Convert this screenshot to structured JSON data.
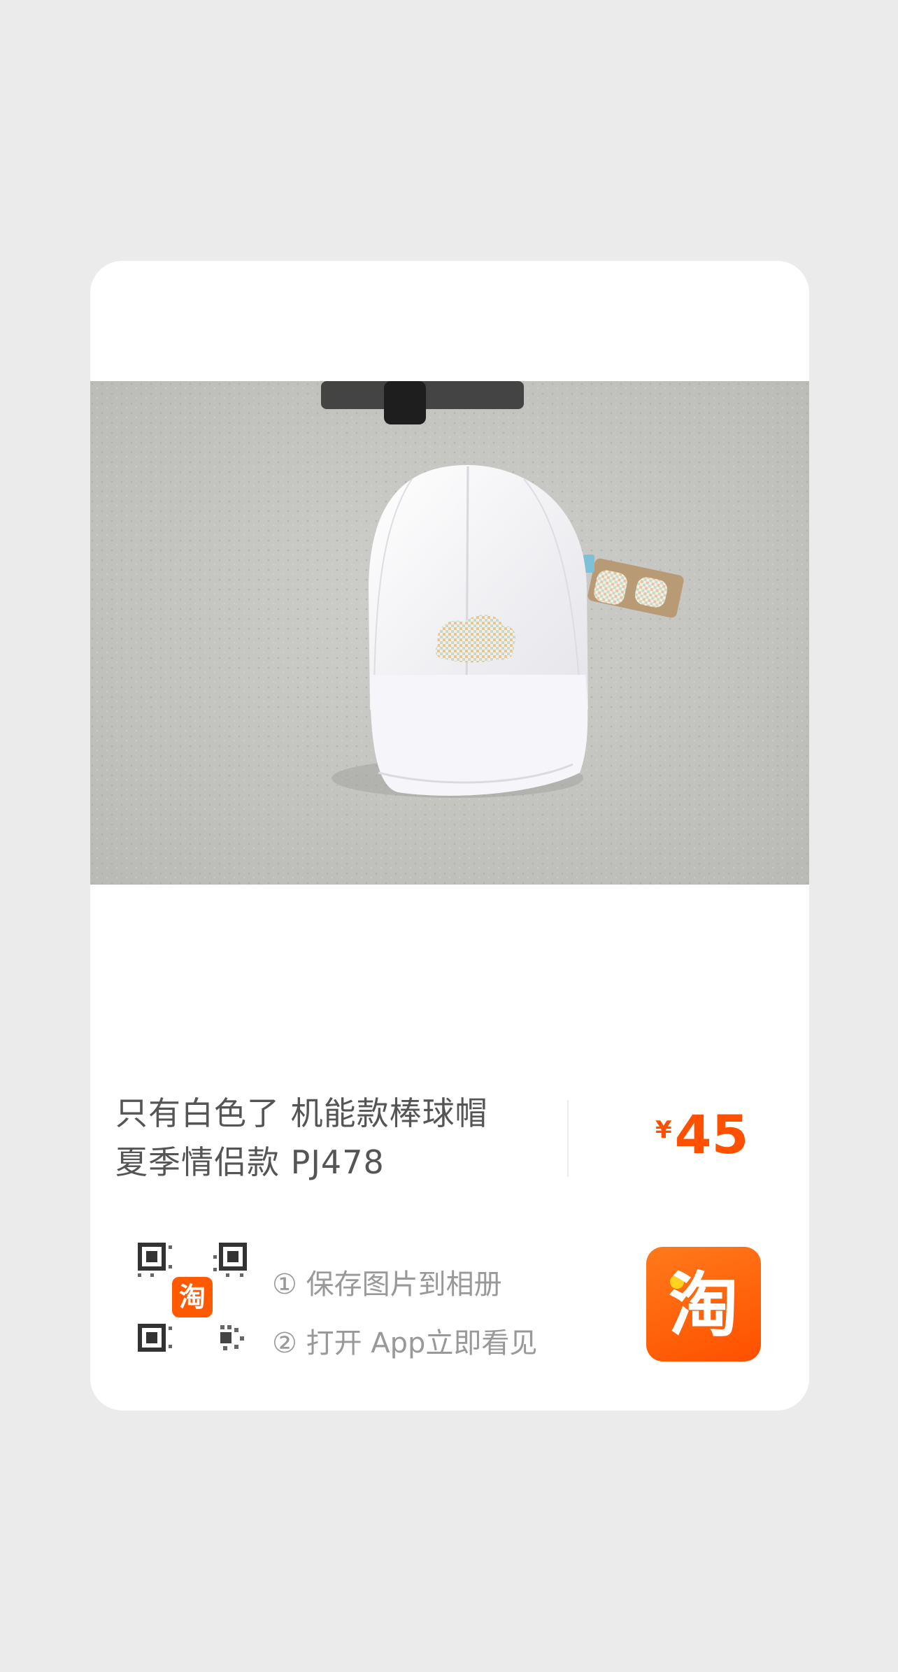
{
  "product": {
    "title_line1": "只有白色了  机能款棒球帽",
    "title_line2": "夏季情侣款 PJ478",
    "currency": "¥",
    "price": "45",
    "image_alt": "white baseball cap on concrete floor"
  },
  "share": {
    "step1": "① 保存图片到相册",
    "step2": "② 打开 App立即看见",
    "qr_badge_glyph": "淘",
    "app_icon_glyph": "淘"
  },
  "colors": {
    "accent": "#ff5000",
    "background": "#ebebeb",
    "card": "#ffffff",
    "title_text": "#555555",
    "hint_text": "#999999"
  }
}
